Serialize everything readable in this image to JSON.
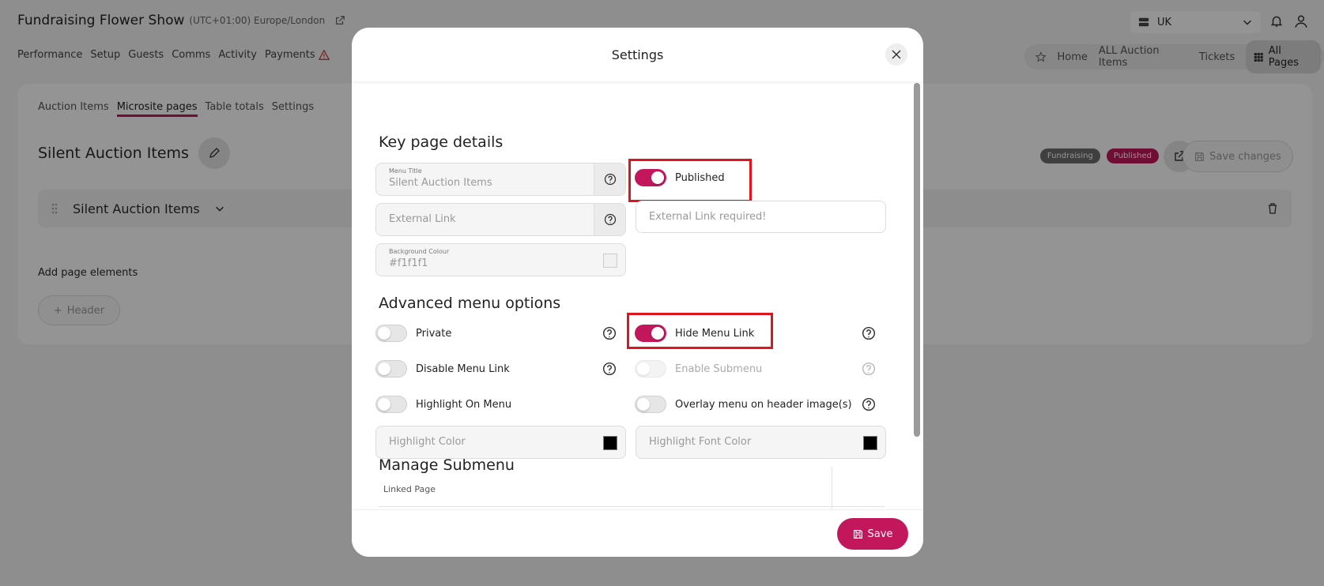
{
  "event": {
    "title": "Fundraising Flower Show",
    "timezone": "(UTC+01:00) Europe/London"
  },
  "main_nav": [
    "Performance",
    "Setup",
    "Guests",
    "Comms",
    "Activity",
    "Payments"
  ],
  "region": {
    "value": "UK"
  },
  "page_nav": {
    "items": [
      "Home",
      "ALL Auction Items",
      "Tickets"
    ],
    "active": "All Pages"
  },
  "sub_tabs": {
    "items": [
      "Auction Items",
      "Microsite pages",
      "Table totals",
      "Settings"
    ],
    "active_index": 1
  },
  "page": {
    "title": "Silent Auction Items",
    "badges": [
      {
        "label": "Fundraising",
        "color": "#6d6d6d"
      },
      {
        "label": "Published",
        "color": "#c2185b"
      }
    ],
    "save_changes": "Save changes",
    "section_name": "Silent Auction Items",
    "add_elements_label": "Add page elements",
    "add_header_label": "Header"
  },
  "modal": {
    "title": "Settings",
    "key_details": {
      "heading": "Key page details",
      "menu_title_label": "Menu Title",
      "menu_title_value": "Silent Auction Items",
      "published_label": "Published",
      "external_link_placeholder": "External Link",
      "external_link_error": "External Link required!",
      "bg_colour_label": "Background Colour",
      "bg_colour_value": "#f1f1f1"
    },
    "advanced": {
      "heading": "Advanced menu options",
      "private": "Private",
      "hide_menu_link": "Hide Menu Link",
      "disable_menu_link": "Disable Menu Link",
      "enable_submenu": "Enable Submenu",
      "highlight_on_menu": "Highlight On Menu",
      "overlay_menu": "Overlay menu on header image(s)",
      "highlight_color": "Highlight Color",
      "highlight_font_color": "Highlight Font Color"
    },
    "submenu": {
      "heading": "Manage Submenu",
      "linked_page_label": "Linked Page"
    },
    "save_label": "Save"
  },
  "colors": {
    "accent": "#c2185b",
    "highlight_box": "#e0141e"
  }
}
